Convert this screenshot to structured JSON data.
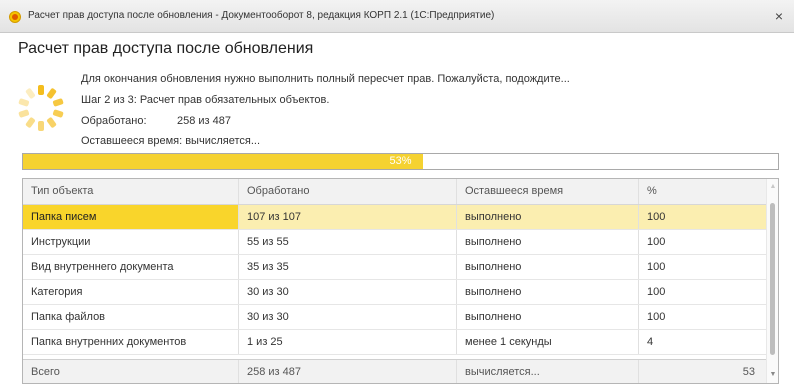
{
  "window": {
    "title": "Расчет прав доступа после обновления - Документооборот 8, редакция КОРП 2.1  (1С:Предприятие)",
    "close_glyph": "×"
  },
  "form": {
    "title": "Расчет прав доступа после обновления",
    "message": "Для окончания обновления нужно выполнить полный пересчет прав. Пожалуйста, подождите...",
    "step": "Шаг 2 из 3: Расчет прав обязательных объектов.",
    "processed_label": "Обработано:",
    "processed_value": "258 из 487",
    "remaining_time": "Оставшееся время: вычисляется..."
  },
  "progress": {
    "label": "53%",
    "value": 53
  },
  "table": {
    "columns": [
      "Тип объекта",
      "Обработано",
      "Оставшееся время",
      "%"
    ],
    "rows": [
      [
        "Папка писем",
        "107 из 107",
        "выполнено",
        "100"
      ],
      [
        "Инструкции",
        "55 из 55",
        "выполнено",
        "100"
      ],
      [
        "Вид внутреннего документа",
        "35 из 35",
        "выполнено",
        "100"
      ],
      [
        "Категория",
        "30 из 30",
        "выполнено",
        "100"
      ],
      [
        "Папка файлов",
        "30 из 30",
        "выполнено",
        "100"
      ],
      [
        "Папка внутренних документов",
        "1 из 25",
        "менее 1 секунды",
        "4"
      ]
    ],
    "footer": [
      "Всего",
      "258 из 487",
      "вычисляется...",
      "53"
    ],
    "selected_row": 0
  },
  "icons": {
    "app": "1c-logo-icon",
    "close": "close-icon",
    "spinner": "loading-spinner-icon",
    "scroll_up": "scroll-up-arrow-icon",
    "scroll_down": "scroll-down-arrow-icon"
  },
  "colors": {
    "accent": "#f9d52b",
    "selected_row": "#fbeeb0",
    "progress_fill": "#f5d231",
    "spinner": "#f4bd1d"
  }
}
